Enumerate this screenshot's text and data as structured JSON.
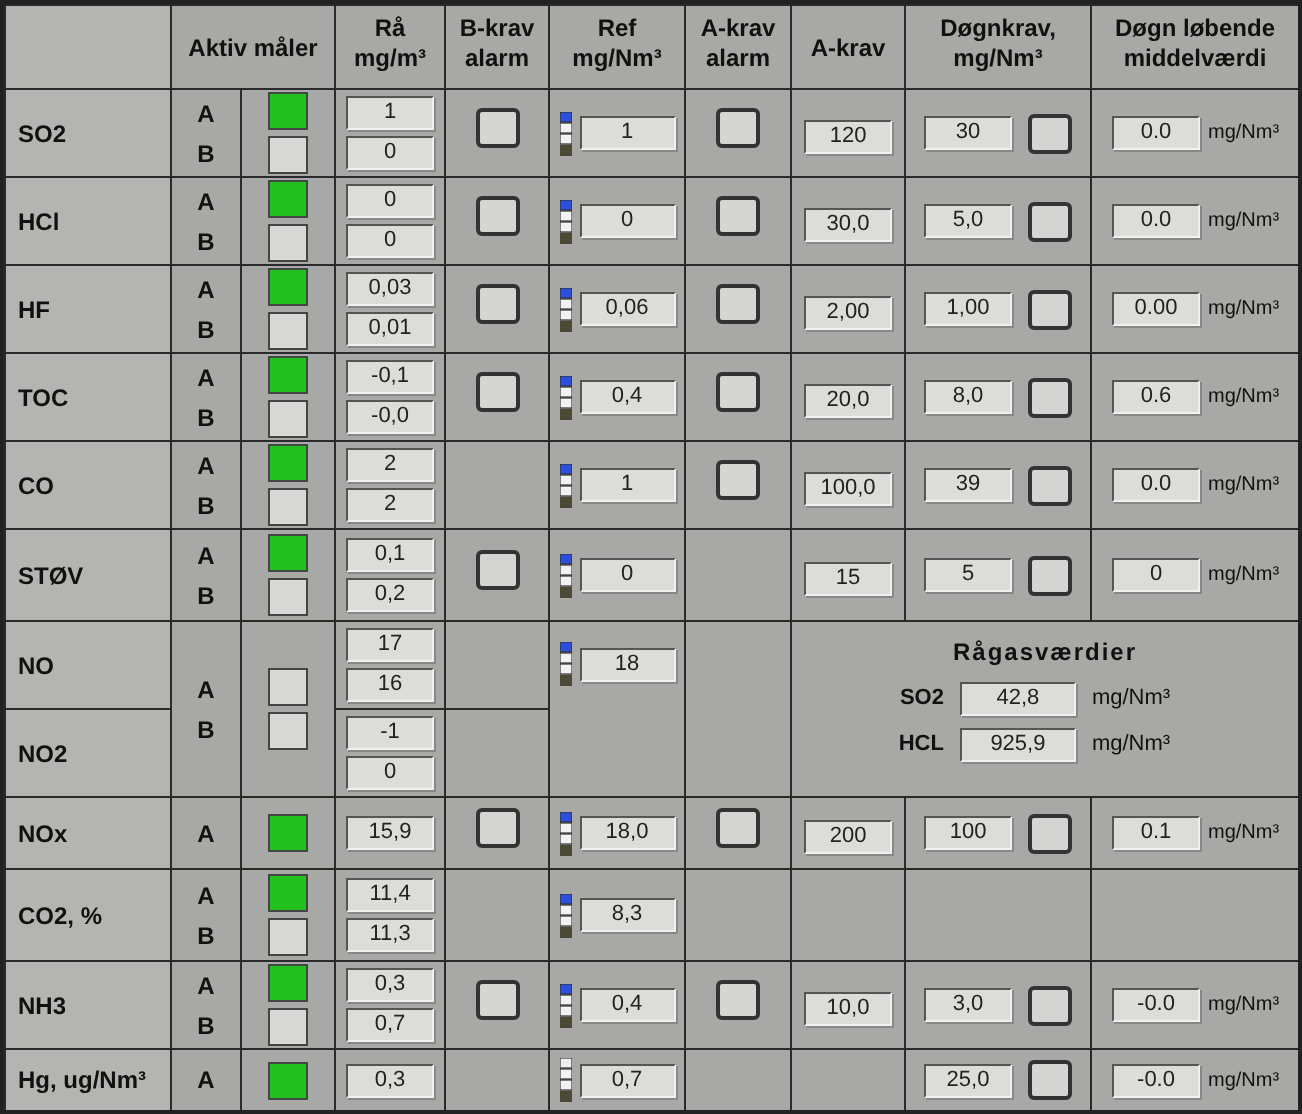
{
  "header": [
    {
      "lines": [
        "Aktiv måler"
      ]
    },
    {
      "lines": [
        "Rå",
        "mg/m³"
      ]
    },
    {
      "lines": [
        "B-krav",
        "alarm"
      ]
    },
    {
      "lines": [
        "Ref",
        "mg/Nm³"
      ]
    },
    {
      "lines": [
        "A-krav",
        "alarm"
      ]
    },
    {
      "lines": [
        "A-krav"
      ]
    },
    {
      "lines": [
        "Døgnkrav,",
        "mg/Nm³"
      ]
    },
    {
      "lines": [
        "Døgn løbende",
        "middelværdi"
      ]
    }
  ],
  "rows": [
    {
      "kind": "single",
      "name": "SO2",
      "meters": [
        {
          "letter": "A",
          "active": true
        },
        {
          "letter": "B",
          "active": false
        }
      ],
      "raw": [
        "1",
        "0"
      ],
      "b_alarm": {
        "checked": false
      },
      "ref": {
        "value": "1",
        "flag": true
      },
      "a_alarm": {
        "checked": false
      },
      "a_krav": "120",
      "dogn": {
        "value": "30",
        "alarm": {
          "checked": false
        }
      },
      "middel": {
        "value": "0.0",
        "unit": "mg/Nm³"
      }
    },
    {
      "kind": "single",
      "name": "HCl",
      "meters": [
        {
          "letter": "A",
          "active": true
        },
        {
          "letter": "B",
          "active": false
        }
      ],
      "raw": [
        "0",
        "0"
      ],
      "b_alarm": {
        "checked": false
      },
      "ref": {
        "value": "0",
        "flag": true
      },
      "a_alarm": {
        "checked": false
      },
      "a_krav": "30,0",
      "dogn": {
        "value": "5,0",
        "alarm": {
          "checked": false
        }
      },
      "middel": {
        "value": "0.0",
        "unit": "mg/Nm³"
      }
    },
    {
      "kind": "single",
      "name": "HF",
      "meters": [
        {
          "letter": "A",
          "active": true
        },
        {
          "letter": "B",
          "active": false
        }
      ],
      "raw": [
        "0,03",
        "0,01"
      ],
      "b_alarm": {
        "checked": false
      },
      "ref": {
        "value": "0,06",
        "flag": true
      },
      "a_alarm": {
        "checked": false
      },
      "a_krav": "2,00",
      "dogn": {
        "value": "1,00",
        "alarm": {
          "checked": false
        }
      },
      "middel": {
        "value": "0.00",
        "unit": "mg/Nm³"
      }
    },
    {
      "kind": "single",
      "name": "TOC",
      "meters": [
        {
          "letter": "A",
          "active": true
        },
        {
          "letter": "B",
          "active": false
        }
      ],
      "raw": [
        "-0,1",
        "-0,0"
      ],
      "b_alarm": {
        "checked": false
      },
      "ref": {
        "value": "0,4",
        "flag": true
      },
      "a_alarm": {
        "checked": false
      },
      "a_krav": "20,0",
      "dogn": {
        "value": "8,0",
        "alarm": {
          "checked": false
        }
      },
      "middel": {
        "value": "0.6",
        "unit": "mg/Nm³"
      }
    },
    {
      "kind": "single",
      "name": "CO",
      "meters": [
        {
          "letter": "A",
          "active": true
        },
        {
          "letter": "B",
          "active": false
        }
      ],
      "raw": [
        "2",
        "2"
      ],
      "ref": {
        "value": "1",
        "flag": true
      },
      "a_alarm": {
        "checked": false
      },
      "a_krav": "100,0",
      "dogn": {
        "value": "39",
        "alarm": {
          "checked": false
        }
      },
      "middel": {
        "value": "0.0",
        "unit": "mg/Nm³"
      }
    },
    {
      "kind": "single",
      "name": "STØV",
      "meters": [
        {
          "letter": "A",
          "active": true
        },
        {
          "letter": "B",
          "active": false
        }
      ],
      "raw": [
        "0,1",
        "0,2"
      ],
      "b_alarm": {
        "checked": false
      },
      "ref": {
        "value": "0",
        "flag": true
      },
      "a_krav": "15",
      "dogn": {
        "value": "5",
        "alarm": {
          "checked": false
        }
      },
      "middel": {
        "value": "0",
        "unit": "mg/Nm³"
      }
    },
    {
      "kind": "pair",
      "meters": [
        {
          "letter": "A",
          "active": false
        },
        {
          "letter": "B",
          "active": false
        }
      ],
      "rows": [
        {
          "name": "NO",
          "raw": [
            "17",
            "16"
          ]
        },
        {
          "name": "NO2",
          "raw": [
            "-1",
            "0"
          ]
        }
      ],
      "ref": {
        "value": "18",
        "flag": true
      },
      "raw_gas": {
        "title": "Rågasværdier",
        "items": [
          {
            "label": "SO2",
            "value": "42,8",
            "unit": "mg/Nm³"
          },
          {
            "label": "HCL",
            "value": "925,9",
            "unit": "mg/Nm³"
          }
        ]
      }
    },
    {
      "kind": "single",
      "name": "NOx",
      "meters": [
        {
          "letter": "A",
          "active": true
        }
      ],
      "raw": [
        "15,9"
      ],
      "b_alarm": {
        "checked": false
      },
      "ref": {
        "value": "18,0",
        "flag": true
      },
      "a_alarm": {
        "checked": false
      },
      "a_krav": "200",
      "dogn": {
        "value": "100",
        "alarm": {
          "checked": false
        }
      },
      "middel": {
        "value": "0.1",
        "unit": "mg/Nm³"
      }
    },
    {
      "kind": "single",
      "name": "CO2, %",
      "meters": [
        {
          "letter": "A",
          "active": true
        },
        {
          "letter": "B",
          "active": false
        }
      ],
      "raw": [
        "11,4",
        "11,3"
      ],
      "ref": {
        "value": "8,3",
        "flag": true
      }
    },
    {
      "kind": "single",
      "name": "NH3",
      "meters": [
        {
          "letter": "A",
          "active": true
        },
        {
          "letter": "B",
          "active": false
        }
      ],
      "raw": [
        "0,3",
        "0,7"
      ],
      "b_alarm": {
        "checked": false
      },
      "ref": {
        "value": "0,4",
        "flag": true
      },
      "a_alarm": {
        "checked": false
      },
      "a_krav": "10,0",
      "dogn": {
        "value": "3,0",
        "alarm": {
          "checked": false
        }
      },
      "middel": {
        "value": "-0.0",
        "unit": "mg/Nm³"
      }
    },
    {
      "kind": "single",
      "name": "Hg, ug/Nm³",
      "meters": [
        {
          "letter": "A",
          "active": true
        }
      ],
      "raw": [
        "0,3"
      ],
      "ref": {
        "value": "0,7",
        "flag": false
      },
      "dogn": {
        "value": "25,0",
        "alarm": {
          "checked": false
        }
      },
      "middel": {
        "value": "-0.0",
        "unit": "mg/Nm³"
      }
    }
  ]
}
